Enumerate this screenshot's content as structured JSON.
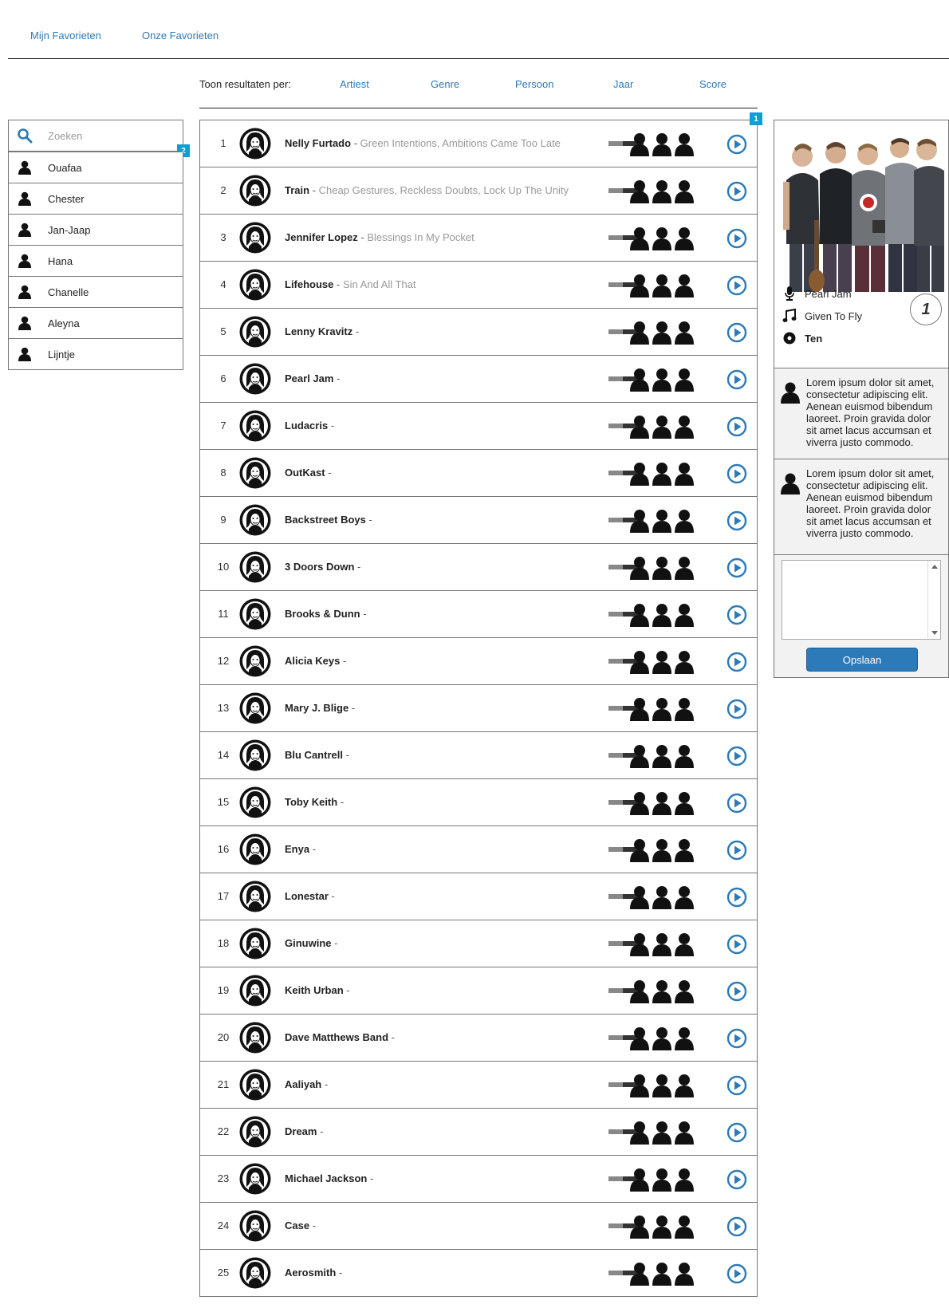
{
  "nav": {
    "tabs": [
      {
        "label": "Mijn Favorieten"
      },
      {
        "label": "Onze Favorieten"
      }
    ]
  },
  "filter": {
    "label": "Toon resultaten per:",
    "options": [
      "Artiest",
      "Genre",
      "Persoon",
      "Jaar",
      "Score"
    ]
  },
  "sidebar": {
    "search_placeholder": "Zoeken",
    "badge": "2",
    "users": [
      "Ouafaa",
      "Chester",
      "Jan-Jaap",
      "Hana",
      "Chanelle",
      "Aleyna",
      "Lijntje"
    ]
  },
  "list": {
    "badge": "1",
    "rows": [
      {
        "rank": "1",
        "artist": "Nelly Furtado",
        "separator": "-",
        "songs": "Green Intentions, Ambitions Came Too Late",
        "score": 0.4
      },
      {
        "rank": "2",
        "artist": "Train",
        "separator": "-",
        "songs": "Cheap Gestures, Reckless Doubts, Lock Up The Unity",
        "score": 0.4
      },
      {
        "rank": "3",
        "artist": "Jennifer Lopez",
        "separator": "-",
        "songs": "Blessings In My Pocket",
        "score": 0.4
      },
      {
        "rank": "4",
        "artist": "Lifehouse",
        "separator": "-",
        "songs": "Sin And All That",
        "score": 0.4
      },
      {
        "rank": "5",
        "artist": "Lenny Kravitz",
        "separator": "-",
        "songs": "",
        "score": 0.4
      },
      {
        "rank": "6",
        "artist": "Pearl Jam",
        "separator": "-",
        "songs": "",
        "score": 0.4
      },
      {
        "rank": "7",
        "artist": "Ludacris",
        "separator": "-",
        "songs": "",
        "score": 0.4
      },
      {
        "rank": "8",
        "artist": "OutKast",
        "separator": "-",
        "songs": "",
        "score": 0.4
      },
      {
        "rank": "9",
        "artist": "Backstreet Boys",
        "separator": "-",
        "songs": "",
        "score": 0.4
      },
      {
        "rank": "10",
        "artist": "3 Doors Down",
        "separator": "-",
        "songs": "",
        "score": 0.4
      },
      {
        "rank": "11",
        "artist": "Brooks & Dunn",
        "separator": "-",
        "songs": "",
        "score": 0.4
      },
      {
        "rank": "12",
        "artist": "Alicia Keys",
        "separator": "-",
        "songs": "",
        "score": 0.4
      },
      {
        "rank": "13",
        "artist": "Mary J. Blige",
        "separator": "-",
        "songs": "",
        "score": 0.4
      },
      {
        "rank": "14",
        "artist": "Blu Cantrell",
        "separator": "-",
        "songs": "",
        "score": 0.4
      },
      {
        "rank": "15",
        "artist": "Toby Keith",
        "separator": "-",
        "songs": "",
        "score": 0.4
      },
      {
        "rank": "16",
        "artist": "Enya",
        "separator": "-",
        "songs": "",
        "score": 0.4
      },
      {
        "rank": "17",
        "artist": "Lonestar",
        "separator": "-",
        "songs": "",
        "score": 0.4
      },
      {
        "rank": "18",
        "artist": "Ginuwine",
        "separator": "-",
        "songs": "",
        "score": 0.4
      },
      {
        "rank": "19",
        "artist": "Keith Urban",
        "separator": "-",
        "songs": "",
        "score": 0.4
      },
      {
        "rank": "20",
        "artist": "Dave Matthews Band",
        "separator": "-",
        "songs": "",
        "score": 0.4
      },
      {
        "rank": "21",
        "artist": "Aaliyah",
        "separator": "-",
        "songs": "",
        "score": 0.4
      },
      {
        "rank": "22",
        "artist": "Dream",
        "separator": "-",
        "songs": "",
        "score": 0.4
      },
      {
        "rank": "23",
        "artist": "Michael Jackson",
        "separator": "-",
        "songs": "",
        "score": 0.4
      },
      {
        "rank": "24",
        "artist": "Case",
        "separator": "-",
        "songs": "",
        "score": 0.4
      },
      {
        "rank": "25",
        "artist": "Aerosmith",
        "separator": "-",
        "songs": "",
        "score": 0.4
      }
    ]
  },
  "detail": {
    "artist": "Pearl Jam",
    "song": "Given To Fly",
    "album": "Ten",
    "rank": "1",
    "comments": [
      {
        "text": "Lorem ipsum dolor sit amet, consectetur adipiscing elit. Aenean euismod bibendum laoreet. Proin gravida dolor sit amet lacus accumsan et viverra justo commodo."
      },
      {
        "text": "Lorem ipsum dolor sit amet, consectetur adipiscing elit. Aenean euismod bibendum laoreet. Proin gravida dolor sit amet lacus accumsan et viverra justo commodo."
      }
    ],
    "comment_input_value": "",
    "save_label": "Opslaan"
  },
  "colors": {
    "link": "#2d7ab8",
    "badge": "#0b9ed8",
    "button": "#2d7ab8"
  },
  "icons": {
    "search": "search-icon",
    "user": "user-icon",
    "play": "play-circle-icon",
    "microphone": "microphone-icon",
    "music_note": "music-note-icon",
    "disc": "disc-icon",
    "avatar": "artist-avatar-icon"
  }
}
